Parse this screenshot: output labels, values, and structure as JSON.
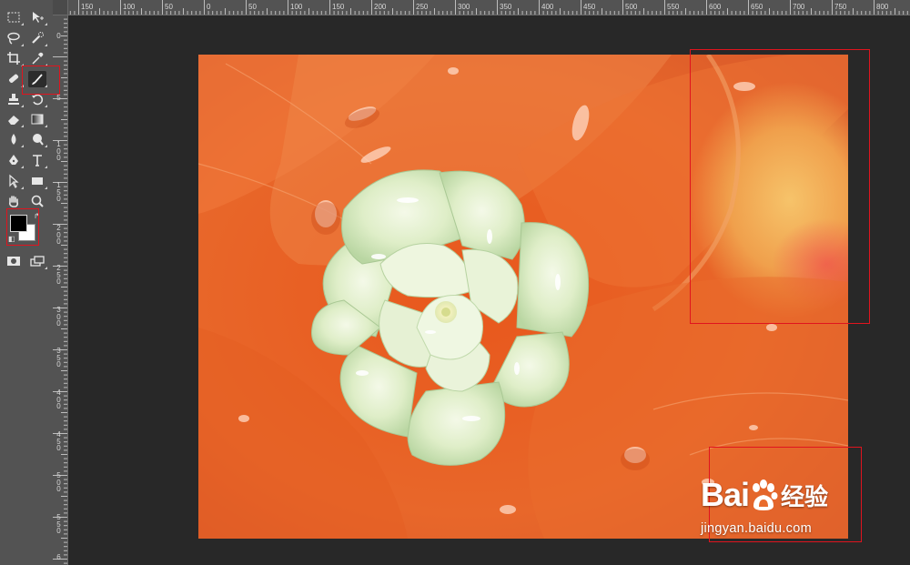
{
  "tools": [
    {
      "name": "rect-marquee-icon",
      "glyph": "⬚"
    },
    {
      "name": "move-tool-icon",
      "glyph": "▸"
    },
    {
      "name": "lasso-icon",
      "glyph": "ℓ"
    },
    {
      "name": "quick-select-icon",
      "glyph": "✎"
    },
    {
      "name": "crop-icon",
      "glyph": "⌗"
    },
    {
      "name": "eyedropper-icon",
      "glyph": "ǀ"
    },
    {
      "name": "healing-brush-icon",
      "glyph": "✐"
    },
    {
      "name": "brush-icon",
      "glyph": "∕"
    },
    {
      "name": "clone-stamp-icon",
      "glyph": "⊥"
    },
    {
      "name": "history-brush-icon",
      "glyph": "↺"
    },
    {
      "name": "eraser-icon",
      "glyph": "◇"
    },
    {
      "name": "gradient-icon",
      "glyph": "▭"
    },
    {
      "name": "blur-icon",
      "glyph": "◖"
    },
    {
      "name": "dodge-icon",
      "glyph": "●"
    },
    {
      "name": "pen-icon",
      "glyph": "✒"
    },
    {
      "name": "type-icon",
      "glyph": "T"
    },
    {
      "name": "path-select-icon",
      "glyph": "▸"
    },
    {
      "name": "shape-icon",
      "glyph": "▬"
    },
    {
      "name": "hand-icon",
      "glyph": "✋"
    },
    {
      "name": "zoom-icon",
      "glyph": "⚲"
    },
    {
      "name": "quick-mask-icon",
      "glyph": "◙"
    },
    {
      "name": "screen-mode-icon",
      "glyph": "▣"
    }
  ],
  "ruler": {
    "top": [
      "150",
      "100",
      "50",
      "0",
      "50",
      "100",
      "150",
      "200",
      "250",
      "300",
      "350",
      "400",
      "450",
      "500",
      "550",
      "600",
      "650",
      "700",
      "750",
      "800"
    ],
    "left": [
      "0",
      "5",
      "1 0 0",
      "1 5 0",
      "2 0 0",
      "2 5 0",
      "3 0 0",
      "3 5 0",
      "4 0 0",
      "4 5 0",
      "5 0 0",
      "5 5 0",
      "6"
    ]
  },
  "watermark": {
    "logo_left": "Bai",
    "logo_right": "经验",
    "url": "jingyan.baidu.com"
  },
  "colors": {
    "foreground": "#000000",
    "background": "#ffffff",
    "callout": "#e0141e",
    "panel": "#535353",
    "workspace": "#282828"
  }
}
